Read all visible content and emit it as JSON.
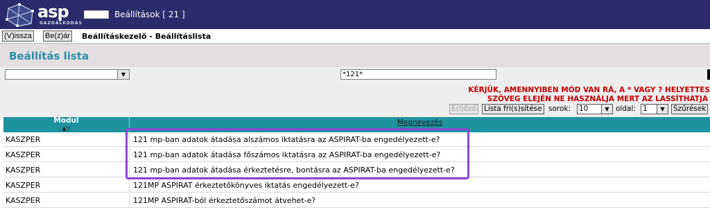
{
  "app": {
    "logo_text": "asp",
    "logo_sub": "GAZDÁLKODÁS",
    "window_title": "Beállítások [ 21 ]"
  },
  "nav": {
    "back_label": "(V)issza",
    "close_label": "Be(z)ár",
    "breadcrumb": "Beállításkezelő - Beállításlista"
  },
  "panel": {
    "title": "Beállítás lista"
  },
  "filter": {
    "module_value": "",
    "search_value": "*121*"
  },
  "warning": {
    "line1": "KÉRJÜK, AMENNYIBEN MÓD VAN RÁ, A * VAGY ? HELYETTES",
    "line2": "SZÖVEG ELEJÉN NE HASZNÁLJA MERT AZ LASSÍTHATJA"
  },
  "controls": {
    "clear_label": "E(l)őző",
    "refresh_label": "Lista fri(s)sítése",
    "rows_label": "sorok:",
    "rows_value": "10",
    "page_label": "oldal:",
    "page_value": "1",
    "filters_label": "Szűrések"
  },
  "table": {
    "col_module": "Modul",
    "col_name": "Megnevezés",
    "rows": [
      {
        "module": "KASZPER",
        "name": "121 mp-ban adatok átadása alszámos iktatásra az ASPIRAT-ba engedélyezett-e?"
      },
      {
        "module": "KASZPER",
        "name": "121 mp-ban adatok átadása főszámos iktatásra az ASPIRAT-ba engedélyezett-e?"
      },
      {
        "module": "KASZPER",
        "name": "121 mp-ban adatok átadása érkeztetésre, bontásra az ASPIRAT-ba engedélyezett-e?"
      },
      {
        "module": "KASZPER",
        "name": "121MP ASPIRAT érkeztetőkönyves iktatás engedélyezett-e?"
      },
      {
        "module": "KASZPER",
        "name": "121MP ASPIRAT-ból érkeztetőszámot átvehet-e?"
      }
    ]
  },
  "colors": {
    "titlebar": "#2b2a6b",
    "accent": "#2a8fa5",
    "header": "#1e93a0",
    "warning": "#c50000",
    "highlight": "#8a46d6"
  }
}
